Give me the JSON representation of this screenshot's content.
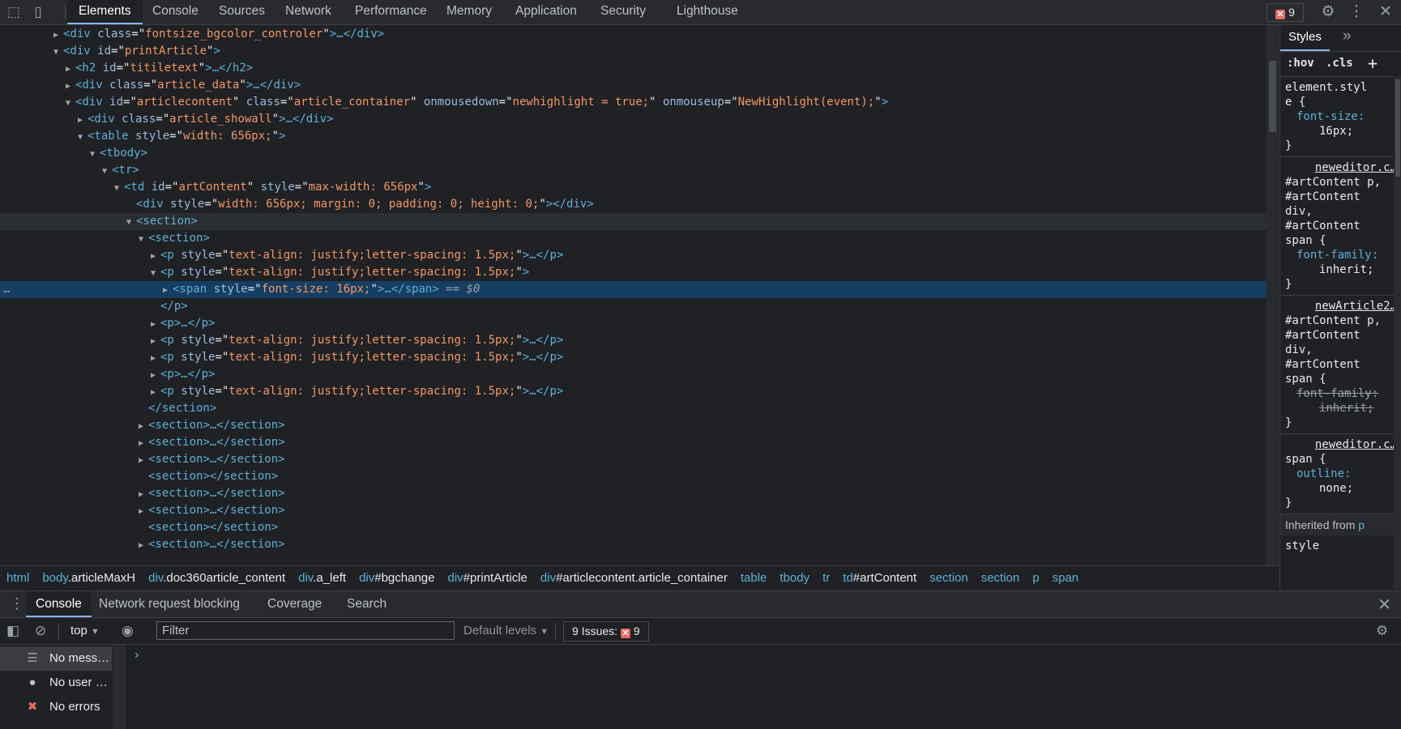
{
  "top_tabs": [
    "Elements",
    "Console",
    "Sources",
    "Network",
    "Performance",
    "Memory",
    "Application",
    "Security",
    "Lighthouse"
  ],
  "issues_count": "9",
  "tree": {
    "lines": [
      {
        "indent": 78,
        "tri": "▶",
        "open": "<div",
        "attrs": [
          [
            "class",
            "fontsize_bgcolor_controler"
          ]
        ],
        "close": ">…</div>"
      },
      {
        "indent": 78,
        "tri": "▼",
        "open": "<div",
        "attrs": [
          [
            "id",
            "printArticle"
          ]
        ],
        "close": ">"
      },
      {
        "indent": 93,
        "tri": "▶",
        "open": "<h2",
        "attrs": [
          [
            "id",
            "titiletext"
          ]
        ],
        "close": ">…</h2>"
      },
      {
        "indent": 93,
        "tri": "▶",
        "open": "<div",
        "attrs": [
          [
            "class",
            "article_data"
          ]
        ],
        "close": ">…</div>"
      },
      {
        "indent": 93,
        "tri": "▼",
        "open": "<div",
        "attrs": [
          [
            "id",
            "articlecontent"
          ],
          [
            "class",
            "article_container"
          ],
          [
            "onmousedown",
            "newhighlight = true;"
          ],
          [
            "onmouseup",
            "NewHighlight(event);"
          ]
        ],
        "close": ">"
      },
      {
        "indent": 108,
        "tri": "▶",
        "open": "<div",
        "attrs": [
          [
            "class",
            "article_showall"
          ]
        ],
        "close": ">…</div>"
      },
      {
        "indent": 108,
        "tri": "▼",
        "open": "<table",
        "attrs": [
          [
            "style",
            "width: 656px;"
          ]
        ],
        "close": ">"
      },
      {
        "indent": 123,
        "tri": "▼",
        "open": "<tbody",
        "attrs": [],
        "close": ">"
      },
      {
        "indent": 138,
        "tri": "▼",
        "open": "<tr",
        "attrs": [],
        "close": ">"
      },
      {
        "indent": 153,
        "tri": "▼",
        "open": "<td",
        "attrs": [
          [
            "id",
            "artContent"
          ],
          [
            "style",
            "max-width: 656px"
          ]
        ],
        "close": ">"
      },
      {
        "indent": 168,
        "tri": "",
        "open": "<div",
        "attrs": [
          [
            "style",
            "width: 656px; margin: 0; padding: 0; height: 0;"
          ]
        ],
        "close": "></div>"
      },
      {
        "indent": 168,
        "tri": "▼",
        "open": "<section",
        "attrs": [],
        "close": ">",
        "state": "hovered"
      },
      {
        "indent": 183,
        "tri": "▼",
        "open": "<section",
        "attrs": [],
        "close": ">"
      },
      {
        "indent": 198,
        "tri": "▶",
        "open": "<p",
        "attrs": [
          [
            "style",
            "text-align: justify;letter-spacing: 1.5px;"
          ]
        ],
        "close": ">…</p>"
      },
      {
        "indent": 198,
        "tri": "▼",
        "open": "<p",
        "attrs": [
          [
            "style",
            "text-align: justify;letter-spacing: 1.5px;"
          ]
        ],
        "close": ">"
      },
      {
        "indent": 213,
        "tri": "▶",
        "open": "<span",
        "attrs": [
          [
            "style",
            "font-size: 16px;"
          ]
        ],
        "close": ">…</span>",
        "suffix": " == $0",
        "state": "selected"
      },
      {
        "indent": 198,
        "tri": "",
        "open": "</p>",
        "attrs": [],
        "close": ""
      },
      {
        "indent": 198,
        "tri": "▶",
        "open": "<p",
        "attrs": [],
        "close": ">…</p>"
      },
      {
        "indent": 198,
        "tri": "▶",
        "open": "<p",
        "attrs": [
          [
            "style",
            "text-align: justify;letter-spacing: 1.5px;"
          ]
        ],
        "close": ">…</p>"
      },
      {
        "indent": 198,
        "tri": "▶",
        "open": "<p",
        "attrs": [
          [
            "style",
            "text-align: justify;letter-spacing: 1.5px;"
          ]
        ],
        "close": ">…</p>"
      },
      {
        "indent": 198,
        "tri": "▶",
        "open": "<p",
        "attrs": [],
        "close": ">…</p>"
      },
      {
        "indent": 198,
        "tri": "▶",
        "open": "<p",
        "attrs": [
          [
            "style",
            "text-align: justify;letter-spacing: 1.5px;"
          ]
        ],
        "close": ">…</p>"
      },
      {
        "indent": 183,
        "tri": "",
        "open": "</section>",
        "attrs": [],
        "close": ""
      },
      {
        "indent": 183,
        "tri": "▶",
        "open": "<section",
        "attrs": [],
        "close": ">…</section>"
      },
      {
        "indent": 183,
        "tri": "▶",
        "open": "<section",
        "attrs": [],
        "close": ">…</section>"
      },
      {
        "indent": 183,
        "tri": "▶",
        "open": "<section",
        "attrs": [],
        "close": ">…</section>"
      },
      {
        "indent": 183,
        "tri": "",
        "open": "<section",
        "attrs": [],
        "close": "></section>"
      },
      {
        "indent": 183,
        "tri": "▶",
        "open": "<section",
        "attrs": [],
        "close": ">…</section>"
      },
      {
        "indent": 183,
        "tri": "▶",
        "open": "<section",
        "attrs": [],
        "close": ">…</section>"
      },
      {
        "indent": 183,
        "tri": "",
        "open": "<section",
        "attrs": [],
        "close": "></section>"
      },
      {
        "indent": 183,
        "tri": "▶",
        "open": "<section",
        "attrs": [],
        "close": ">…</section>"
      }
    ]
  },
  "styles": {
    "tab": "Styles",
    "hov": ":hov",
    "cls": ".cls",
    "rules": [
      {
        "source": "",
        "selector": "element.styl\ne {",
        "props": [
          {
            "name": "font-size",
            "value": "16px;",
            "strike": false
          }
        ]
      },
      {
        "source": "neweditor.c…",
        "selector": "#artContent p,\n#artContent\ndiv,\n#artContent\nspan {",
        "props": [
          {
            "name": "font-family",
            "value": "inherit;",
            "strike": false
          }
        ]
      },
      {
        "source": "newArticle2…",
        "selector": "#artContent p,\n#artContent\ndiv,\n#artContent\nspan {",
        "props": [
          {
            "name": "font-family",
            "value": "inherit;",
            "strike": true
          }
        ]
      },
      {
        "source": "neweditor.c…",
        "selector": "span {",
        "props": [
          {
            "name": "outline",
            "value": "none;",
            "strike": false
          }
        ]
      }
    ],
    "inherited": "Inherited from",
    "inherited_link": "p",
    "last": "style"
  },
  "breadcrumb": [
    {
      "tag": "html",
      "rest": ""
    },
    {
      "tag": "body",
      "rest": ".articleMaxH"
    },
    {
      "tag": "div",
      "rest": ".doc360article_content"
    },
    {
      "tag": "div",
      "rest": ".a_left"
    },
    {
      "tag": "div",
      "rest": "#bgchange"
    },
    {
      "tag": "div",
      "rest": "#printArticle"
    },
    {
      "tag": "div",
      "rest": "#articlecontent.article_container"
    },
    {
      "tag": "table",
      "rest": ""
    },
    {
      "tag": "tbody",
      "rest": ""
    },
    {
      "tag": "tr",
      "rest": ""
    },
    {
      "tag": "td",
      "rest": "#artContent"
    },
    {
      "tag": "section",
      "rest": ""
    },
    {
      "tag": "section",
      "rest": ""
    },
    {
      "tag": "p",
      "rest": ""
    },
    {
      "tag": "span",
      "rest": ""
    }
  ],
  "drawer": {
    "tabs": [
      "Console",
      "Network request blocking",
      "Coverage",
      "Search"
    ],
    "context": "top",
    "filter_placeholder": "Filter",
    "levels": "Default levels",
    "issues_label": "9 Issues:",
    "issues_count": "9",
    "sidebar": [
      {
        "label": "No mess…",
        "icon": "list-icon"
      },
      {
        "label": "No user …",
        "icon": "user-icon"
      },
      {
        "label": "No errors",
        "icon": "error-icon"
      }
    ],
    "prompt": "›"
  },
  "colors": {
    "accent": "#8ab4f8",
    "selected_row": "#163e63",
    "tag": "#5db0d7",
    "attr_value": "#f29766"
  }
}
